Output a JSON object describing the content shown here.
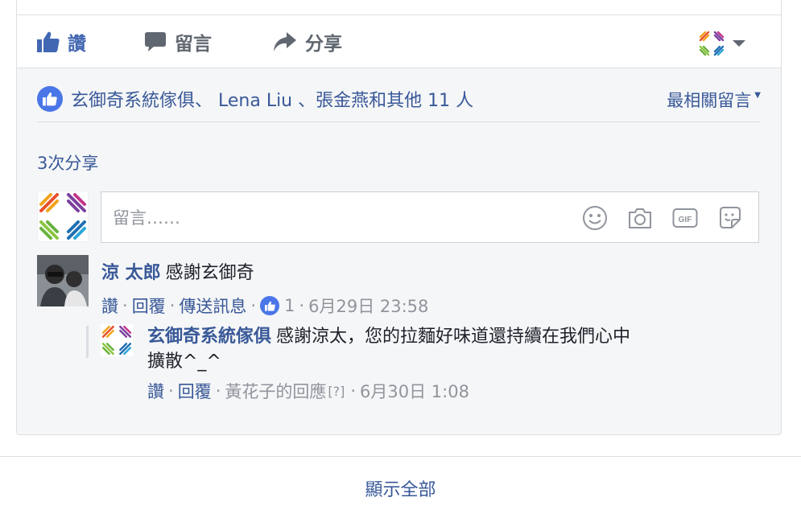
{
  "action_bar": {
    "like_label": "讚",
    "comment_label": "留言",
    "share_label": "分享"
  },
  "reactions": {
    "likes_text": "玄御奇系統傢俱、 Lena Liu 、張金燕和其他 11 人",
    "sort_label": "最相關留言"
  },
  "shares": {
    "text": "3次分享"
  },
  "composer": {
    "placeholder": "留言……",
    "tools": [
      "emoji-icon",
      "camera-icon",
      "gif-icon",
      "sticker-icon"
    ],
    "gif_text": "GIF"
  },
  "comments": [
    {
      "author": "涼 太郎",
      "text": "感謝玄御奇",
      "like_action": "讚",
      "reply_action": "回覆",
      "message_action": "傳送訊息",
      "like_count": "1",
      "timestamp": "6月29日 23:58",
      "replies": [
        {
          "author": "玄御奇系統傢俱",
          "text_line1": "感謝涼太，您的拉麵好味道還持續在我們心中",
          "text_line2": "擴散^_^",
          "like_action": "讚",
          "reply_action": "回覆",
          "responder": "黃花子的回應",
          "help_mark": "[?]",
          "timestamp": "6月30日 1:08"
        }
      ]
    }
  ],
  "footer": {
    "show_all": "顯示全部"
  },
  "colors": {
    "link_blue": "#385898",
    "like_blue": "#4267b2",
    "meta_gray": "#90949c",
    "border": "#dddfe2",
    "comment_bg": "#f5f6f7"
  }
}
